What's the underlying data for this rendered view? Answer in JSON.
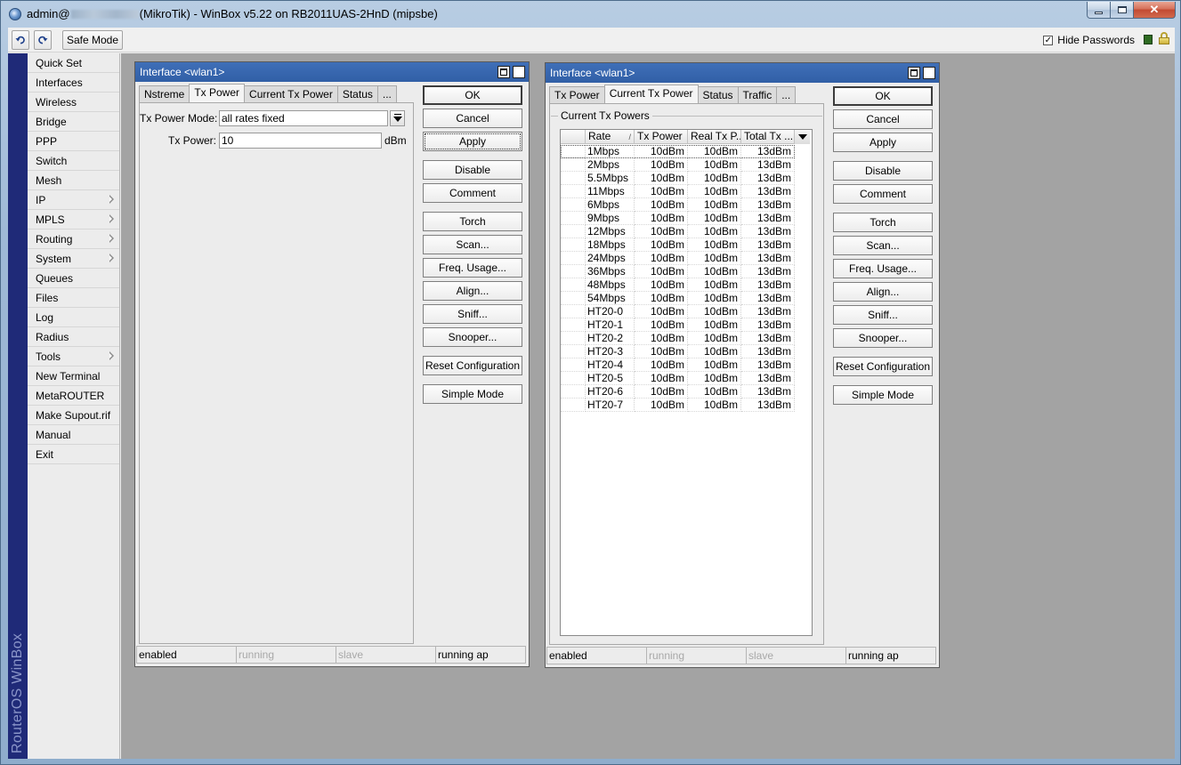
{
  "window": {
    "title_prefix": "admin@",
    "title_suffix": "(MikroTik) - WinBox v5.22 on RB2011UAS-2HnD (mipsbe)"
  },
  "toolbar": {
    "undo_icon": "undo-icon",
    "redo_icon": "redo-icon",
    "safe_mode": "Safe Mode",
    "hide_passwords": "Hide Passwords",
    "hide_passwords_checked": "✓"
  },
  "brand": "RouterOS WinBox",
  "menu": [
    {
      "label": "Quick Set"
    },
    {
      "label": "Interfaces"
    },
    {
      "label": "Wireless"
    },
    {
      "label": "Bridge"
    },
    {
      "label": "PPP"
    },
    {
      "label": "Switch"
    },
    {
      "label": "Mesh"
    },
    {
      "label": "IP"
    },
    {
      "label": "MPLS"
    },
    {
      "label": "Routing"
    },
    {
      "label": "System"
    },
    {
      "label": "Queues"
    },
    {
      "label": "Files"
    },
    {
      "label": "Log"
    },
    {
      "label": "Radius"
    },
    {
      "label": "Tools"
    },
    {
      "label": "New Terminal"
    },
    {
      "label": "MetaROUTER"
    },
    {
      "label": "Make Supout.rif"
    },
    {
      "label": "Manual"
    },
    {
      "label": "Exit"
    }
  ],
  "dialog1": {
    "title": "Interface <wlan1>",
    "tabs": [
      "Nstreme",
      "Tx Power",
      "Current Tx Power",
      "Status",
      "..."
    ],
    "tx_power_mode_label": "Tx Power Mode:",
    "tx_power_mode_value": "all rates fixed",
    "tx_power_label": "Tx Power:",
    "tx_power_value": "10",
    "tx_power_unit": "dBm"
  },
  "dialog2": {
    "title": "Interface <wlan1>",
    "tabs": [
      "Tx Power",
      "Current Tx Power",
      "Status",
      "Traffic",
      "..."
    ],
    "group_label": "Current Tx Powers",
    "columns": [
      "Rate",
      "Tx Power",
      "Real Tx P...",
      "Total Tx ..."
    ],
    "sort_indicator": "/",
    "rows": [
      [
        "1Mbps",
        "10dBm",
        "10dBm",
        "13dBm"
      ],
      [
        "2Mbps",
        "10dBm",
        "10dBm",
        "13dBm"
      ],
      [
        "5.5Mbps",
        "10dBm",
        "10dBm",
        "13dBm"
      ],
      [
        "11Mbps",
        "10dBm",
        "10dBm",
        "13dBm"
      ],
      [
        "6Mbps",
        "10dBm",
        "10dBm",
        "13dBm"
      ],
      [
        "9Mbps",
        "10dBm",
        "10dBm",
        "13dBm"
      ],
      [
        "12Mbps",
        "10dBm",
        "10dBm",
        "13dBm"
      ],
      [
        "18Mbps",
        "10dBm",
        "10dBm",
        "13dBm"
      ],
      [
        "24Mbps",
        "10dBm",
        "10dBm",
        "13dBm"
      ],
      [
        "36Mbps",
        "10dBm",
        "10dBm",
        "13dBm"
      ],
      [
        "48Mbps",
        "10dBm",
        "10dBm",
        "13dBm"
      ],
      [
        "54Mbps",
        "10dBm",
        "10dBm",
        "13dBm"
      ],
      [
        "HT20-0",
        "10dBm",
        "10dBm",
        "13dBm"
      ],
      [
        "HT20-1",
        "10dBm",
        "10dBm",
        "13dBm"
      ],
      [
        "HT20-2",
        "10dBm",
        "10dBm",
        "13dBm"
      ],
      [
        "HT20-3",
        "10dBm",
        "10dBm",
        "13dBm"
      ],
      [
        "HT20-4",
        "10dBm",
        "10dBm",
        "13dBm"
      ],
      [
        "HT20-5",
        "10dBm",
        "10dBm",
        "13dBm"
      ],
      [
        "HT20-6",
        "10dBm",
        "10dBm",
        "13dBm"
      ],
      [
        "HT20-7",
        "10dBm",
        "10dBm",
        "13dBm"
      ]
    ]
  },
  "buttons": [
    "OK",
    "Cancel",
    "Apply",
    "Disable",
    "Comment",
    "Torch",
    "Scan...",
    "Freq. Usage...",
    "Align...",
    "Sniff...",
    "Snooper...",
    "Reset Configuration",
    "Simple Mode"
  ],
  "status": [
    "enabled",
    "running",
    "slave",
    "running ap"
  ]
}
